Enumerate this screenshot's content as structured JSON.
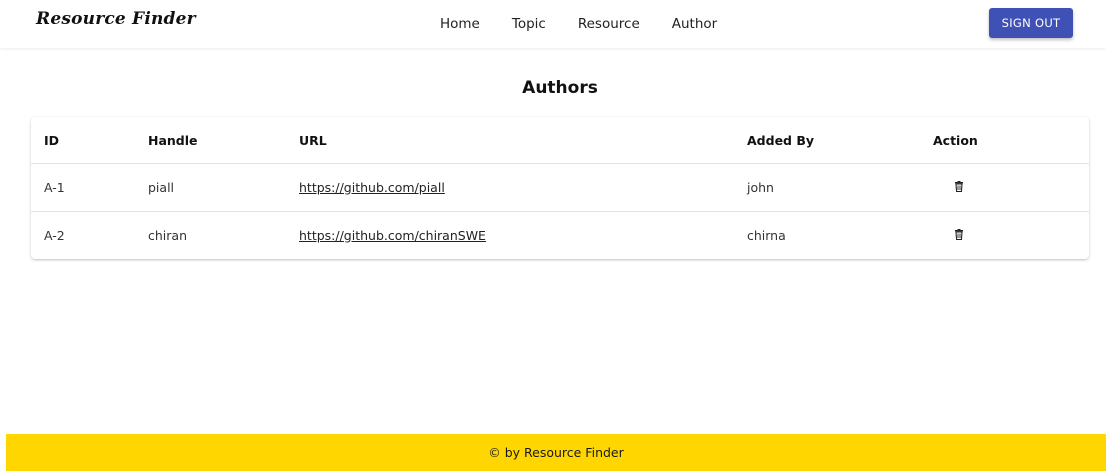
{
  "brand": "Resource Finder",
  "nav": {
    "links": [
      "Home",
      "Topic",
      "Resource",
      "Author"
    ],
    "sign_out_label": "SIGN OUT"
  },
  "page": {
    "title": "Authors"
  },
  "table": {
    "headers": [
      "ID",
      "Handle",
      "URL",
      "Added By",
      "Action"
    ],
    "rows": [
      {
        "id": "A-1",
        "handle": "piall",
        "url": "https://github.com/piall",
        "added_by": "john",
        "action_icon": "trash-icon"
      },
      {
        "id": "A-2",
        "handle": "chiran",
        "url": "https://github.com/chiranSWE",
        "added_by": "chirna",
        "action_icon": "trash-icon"
      }
    ]
  },
  "footer": {
    "text": "© by Resource Finder"
  },
  "colors": {
    "accent": "#3f51b5",
    "footer_bg": "#ffd600"
  }
}
